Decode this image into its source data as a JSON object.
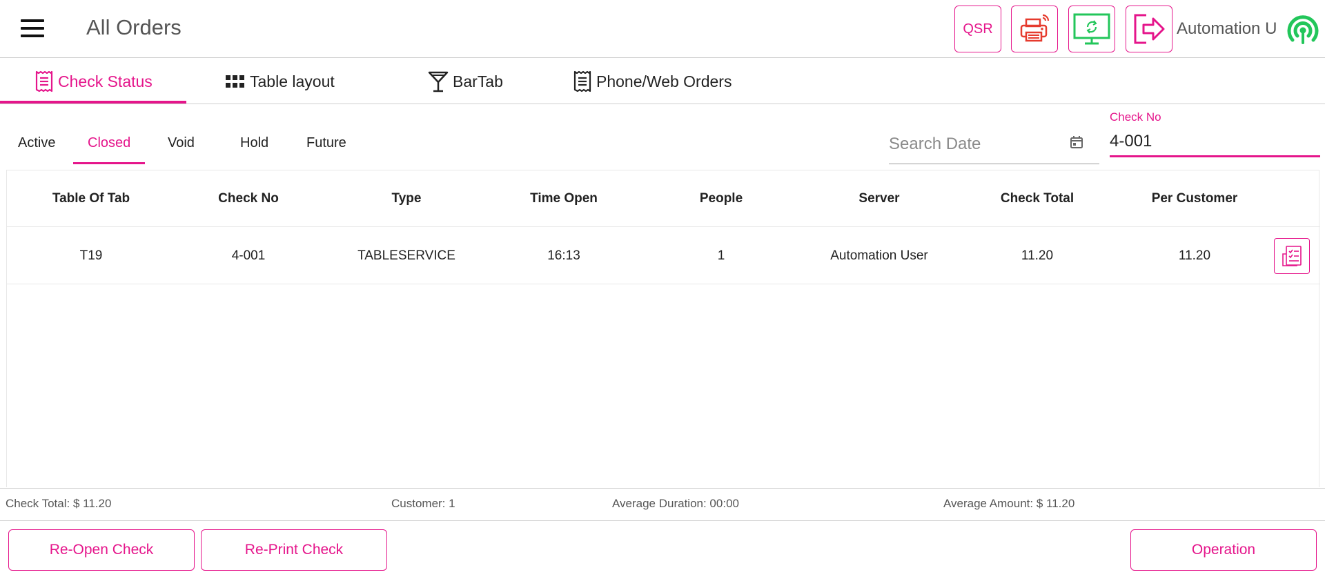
{
  "header": {
    "title": "All Orders",
    "qsr_label": "QSR",
    "user_name": "Automation U",
    "colors": {
      "accent": "#e5158b",
      "printer": "#e63b2e",
      "sync": "#22c65a",
      "signal": "#22c65a"
    }
  },
  "main_tabs": [
    {
      "label": "Check Status",
      "icon": "receipt-icon",
      "active": true
    },
    {
      "label": "Table layout",
      "icon": "grid-icon",
      "active": false
    },
    {
      "label": "BarTab",
      "icon": "cocktail-icon",
      "active": false
    },
    {
      "label": "Phone/Web Orders",
      "icon": "receipt-icon",
      "active": false
    }
  ],
  "sub_tabs": [
    {
      "label": "Active",
      "active": false
    },
    {
      "label": "Closed",
      "active": true
    },
    {
      "label": "Void",
      "active": false
    },
    {
      "label": "Hold",
      "active": false
    },
    {
      "label": "Future",
      "active": false
    }
  ],
  "search_date": {
    "placeholder": "Search Date",
    "value": ""
  },
  "check_no": {
    "label": "Check No",
    "value": "4-001"
  },
  "table": {
    "columns": [
      "Table Of Tab",
      "Check No",
      "Type",
      "Time Open",
      "People",
      "Server",
      "Check Total",
      "Per Customer"
    ],
    "rows": [
      [
        "T19",
        "4-001",
        "TABLESERVICE",
        "16:13",
        "1",
        "Automation User",
        "11.20",
        "11.20"
      ]
    ]
  },
  "summary": {
    "check_total": "Check Total: $ 11.20",
    "customer": "Customer: 1",
    "avg_duration": "Average Duration: 00:00",
    "avg_amount": "Average Amount: $ 11.20"
  },
  "buttons": {
    "reopen": "Re-Open Check",
    "reprint": "Re-Print Check",
    "operation": "Operation"
  }
}
